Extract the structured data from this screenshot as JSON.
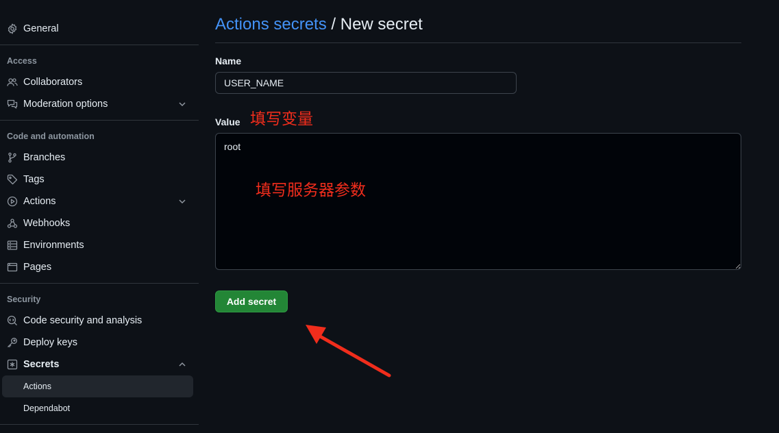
{
  "sidebar": {
    "general": "General",
    "sections": {
      "access": "Access",
      "code_automation": "Code and automation",
      "security": "Security"
    },
    "items": {
      "collaborators": "Collaborators",
      "moderation": "Moderation options",
      "branches": "Branches",
      "tags": "Tags",
      "actions": "Actions",
      "webhooks": "Webhooks",
      "environments": "Environments",
      "pages": "Pages",
      "code_security": "Code security and analysis",
      "deploy_keys": "Deploy keys",
      "secrets": "Secrets"
    },
    "secrets_sub": {
      "actions": "Actions",
      "dependabot": "Dependabot"
    },
    "icons": {
      "general": "gear-icon",
      "collaborators": "people-icon",
      "moderation": "comment-discussion-icon",
      "branches": "git-branch-icon",
      "tags": "tag-icon",
      "actions": "play-icon",
      "webhooks": "webhook-icon",
      "environments": "server-icon",
      "pages": "browser-icon",
      "code_security": "codescan-icon",
      "deploy_keys": "key-icon",
      "secrets": "asterisk-icon"
    }
  },
  "main": {
    "breadcrumb_link": "Actions secrets",
    "breadcrumb_sep": " / ",
    "breadcrumb_current": "New secret",
    "name_label": "Name",
    "name_value": "USER_NAME",
    "value_label": "Value",
    "value_text": "root",
    "submit_label": "Add secret"
  },
  "annotations": {
    "variable_note": "填写变量",
    "param_note": "填写服务器参数",
    "color": "#f02d1c"
  },
  "colors": {
    "background": "#0d1117",
    "link": "#4493f8",
    "button": "#238636",
    "border": "#30363d",
    "muted": "#8d96a0"
  }
}
